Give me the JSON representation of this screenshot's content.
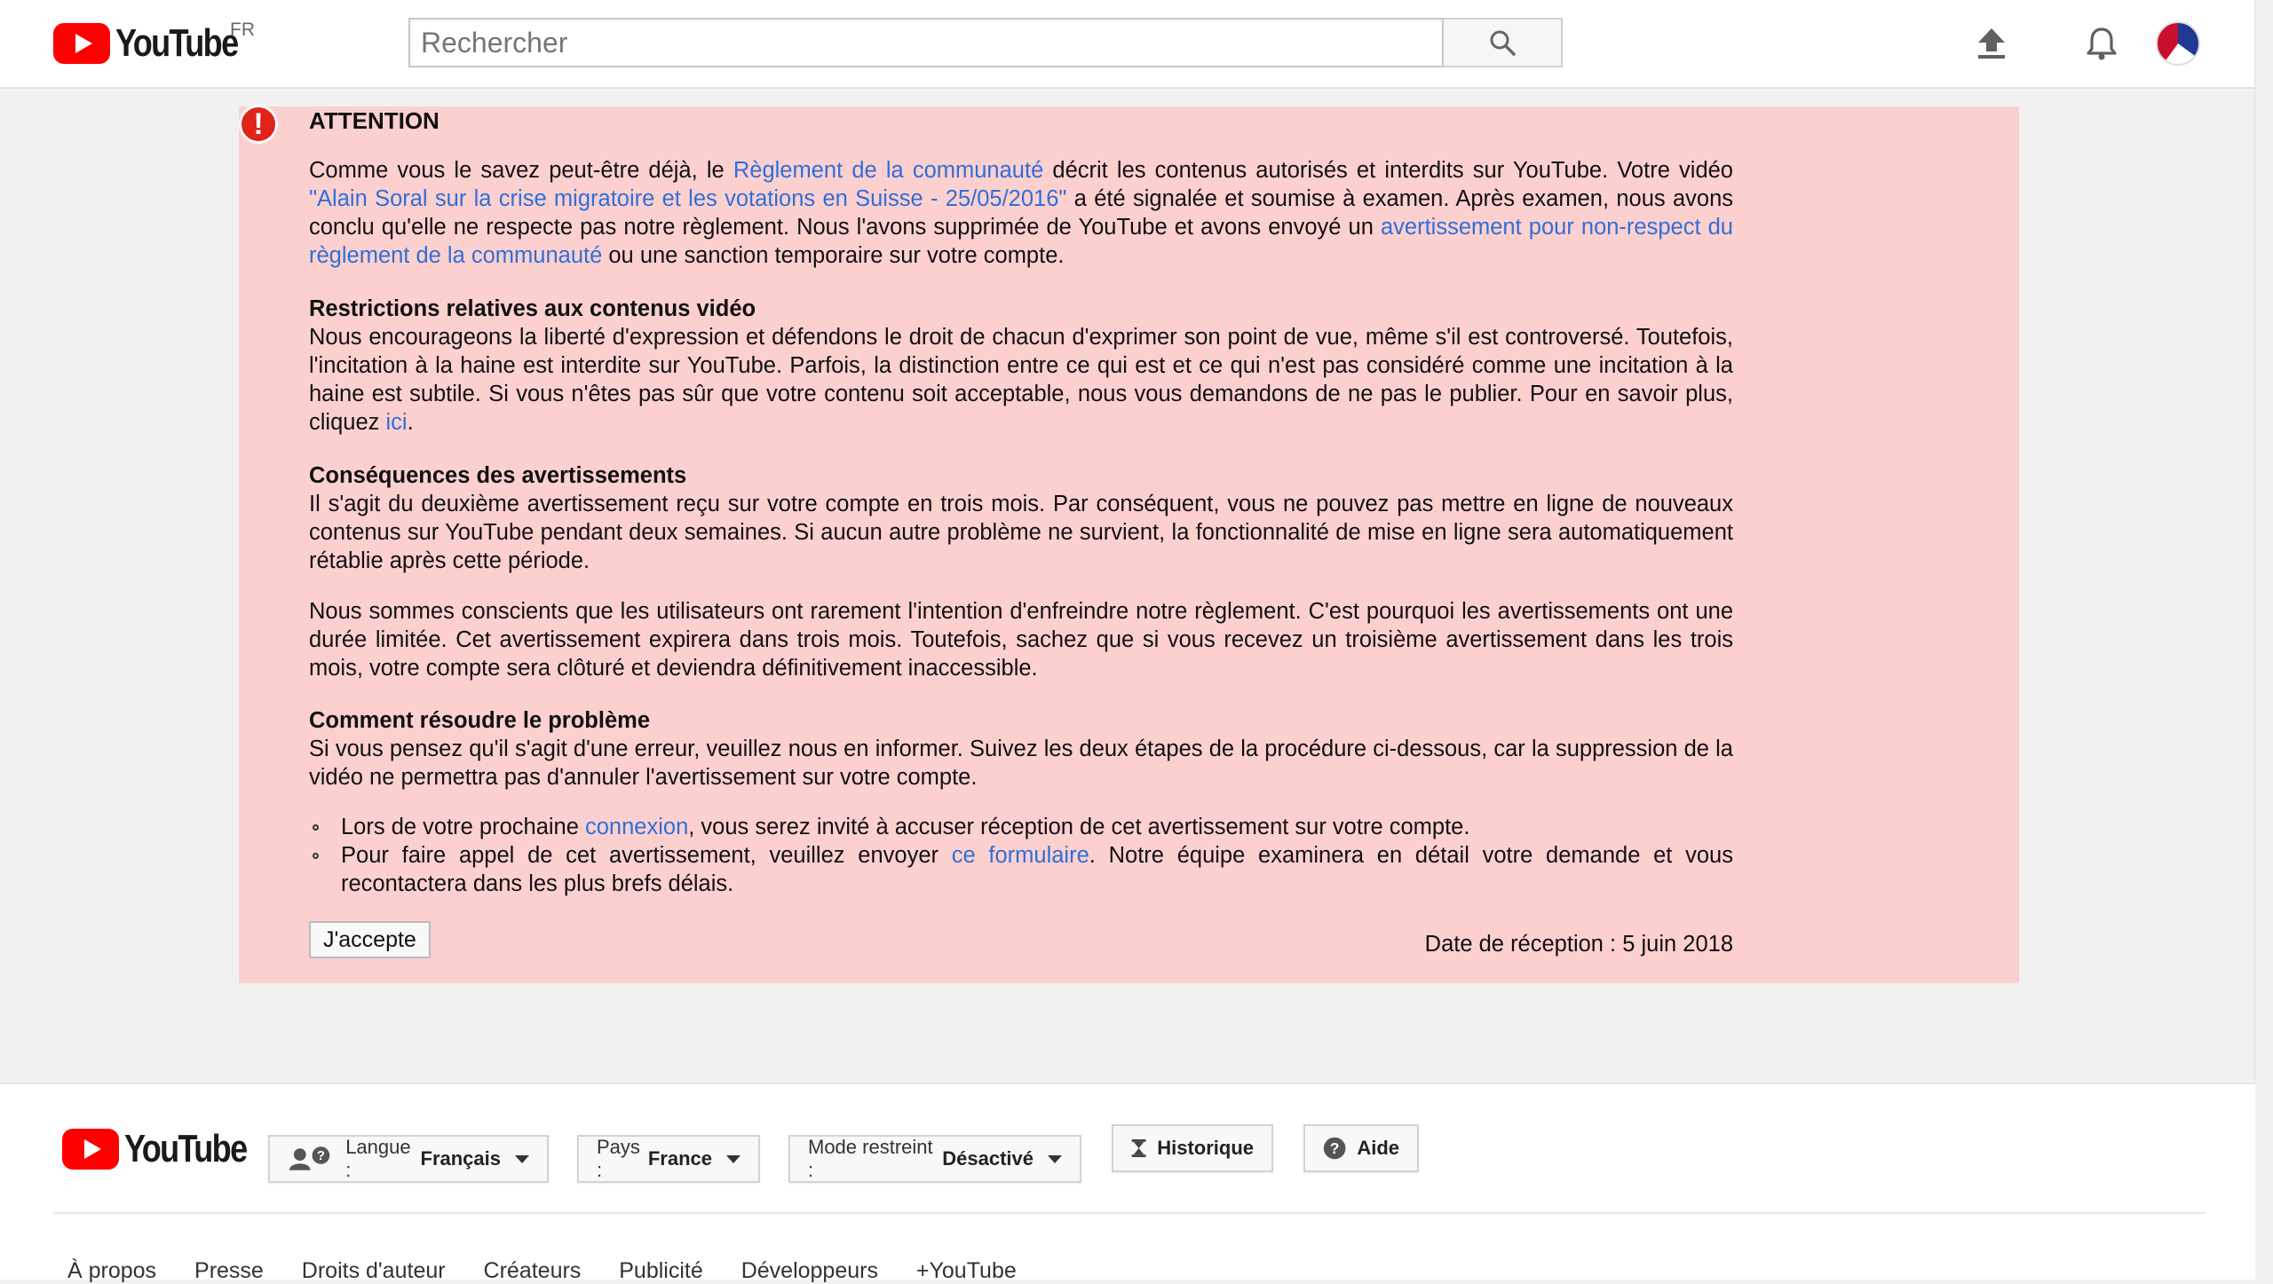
{
  "header": {
    "logo_text": "YouTube",
    "region": "FR",
    "search_placeholder": "Rechercher"
  },
  "notice": {
    "title": "ATTENTION",
    "intro": {
      "t1": "Comme vous le savez peut-être déjà, le ",
      "link1": "Règlement de la communauté",
      "t2": " décrit les contenus autorisés et interdits sur YouTube. Votre vidéo ",
      "link2": "\"Alain Soral sur la crise migratoire et les votations en Suisse - 25/05/2016\"",
      "t3": " a été signalée et soumise à examen. Après examen, nous avons conclu qu'elle ne respecte pas notre règlement. Nous l'avons supprimée de YouTube et avons envoyé un ",
      "link3": "avertissement pour non-respect du règlement de la communauté",
      "t4": " ou une sanction temporaire sur votre compte."
    },
    "restrictions": {
      "heading": "Restrictions relatives aux contenus vidéo",
      "t1": "Nous encourageons la liberté d'expression et défendons le droit de chacun d'exprimer son point de vue, même s'il est controversé. Toutefois, l'incitation à la haine est interdite sur YouTube. Parfois, la distinction entre ce qui est et ce qui n'est pas considéré comme une incitation à la haine est subtile. Si vous n'êtes pas sûr que votre contenu soit acceptable, nous vous demandons de ne pas le publier. Pour en savoir plus, cliquez ",
      "link": "ici",
      "t2": "."
    },
    "consequences": {
      "heading": "Conséquences des avertissements",
      "text": "Il s'agit du deuxième avertissement reçu sur votre compte en trois mois. Par conséquent, vous ne pouvez pas mettre en ligne de nouveaux contenus sur YouTube pendant deux semaines. Si aucun autre problème ne survient, la fonctionnalité de mise en ligne sera automatiquement rétablie après cette période."
    },
    "awareness": "Nous sommes conscients que les utilisateurs ont rarement l'intention d'enfreindre notre règlement. C'est pourquoi les avertissements ont une durée limitée. Cet avertissement expirera dans trois mois. Toutefois, sachez que si vous recevez un troisième avertissement dans les trois mois, votre compte sera clôturé et deviendra définitivement inaccessible.",
    "resolve": {
      "heading": "Comment résoudre le problème",
      "text": "Si vous pensez qu'il s'agit d'une erreur, veuillez nous en informer. Suivez les deux étapes de la procédure ci-dessous, car la suppression de la vidéo ne permettra pas d'annuler l'avertissement sur votre compte."
    },
    "bullet1": {
      "t1": "Lors de votre prochaine ",
      "link": "connexion",
      "t2": ", vous serez invité à accuser réception de cet avertissement sur votre compte."
    },
    "bullet2": {
      "t1": "Pour faire appel de cet avertissement, veuillez envoyer ",
      "link": "ce formulaire",
      "t2": ". Notre équipe examinera en détail votre demande et vous recontactera dans les plus brefs délais."
    },
    "accept_label": "J'accepte",
    "receipt": "Date de réception : 5 juin 2018"
  },
  "footer": {
    "logo_text": "YouTube",
    "language_label": "Langue : ",
    "language_value": "Français",
    "country_label": "Pays : ",
    "country_value": "France",
    "restricted_label": "Mode restreint : ",
    "restricted_value": "Désactivé",
    "history_label": "Historique",
    "help_label": "Aide",
    "links": [
      "À propos",
      "Presse",
      "Droits d'auteur",
      "Créateurs",
      "Publicité",
      "Développeurs",
      "+YouTube"
    ]
  },
  "colors": {
    "brand_red": "#ff0000",
    "notice_bg": "#fdd0d0",
    "link_blue": "#2f6fd6"
  }
}
